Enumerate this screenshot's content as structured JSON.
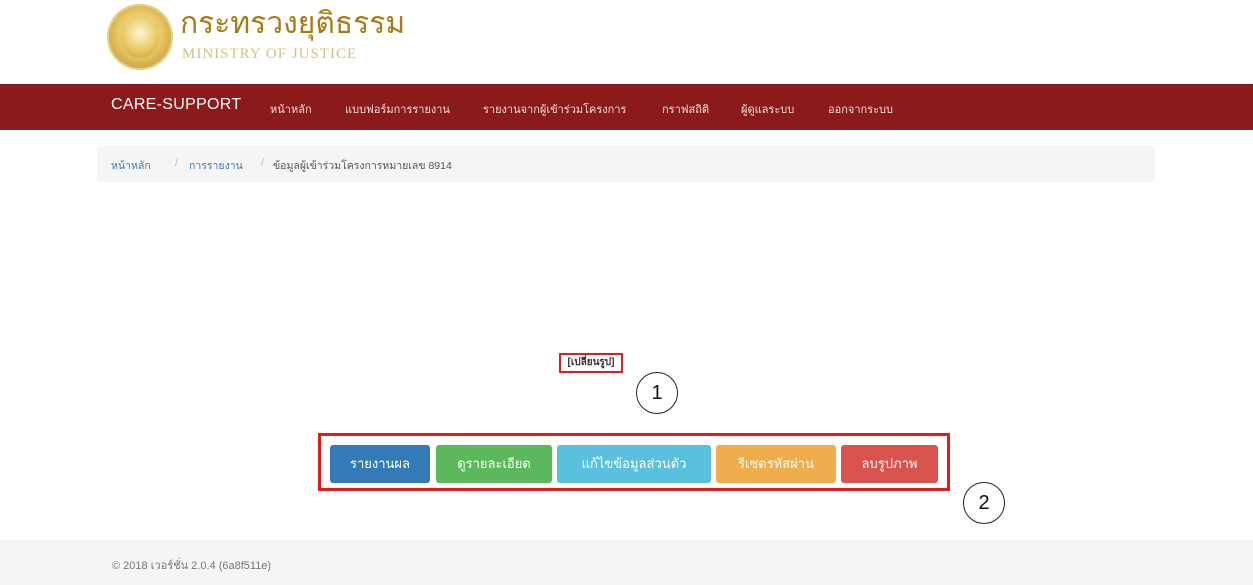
{
  "header": {
    "brand_thai": "กระทรวงยุติธรรม",
    "brand_english": "MINISTRY OF JUSTICE"
  },
  "navbar": {
    "brand": "CARE-SUPPORT",
    "items": [
      {
        "label": "หน้าหลัก"
      },
      {
        "label": "แบบฟอร์มการรายงาน"
      },
      {
        "label": "รายงานจากผู้เข้าร่วมโครงการ"
      },
      {
        "label": "กราฟสถิติ"
      },
      {
        "label": "ผู้ดูแลระบบ"
      },
      {
        "label": "ออกจากระบบ"
      }
    ],
    "color": "#8b1a1a"
  },
  "breadcrumb": {
    "home": "หน้าหลัก",
    "reports": "การรายงาน",
    "current": "ข้อมูลผู้เข้าร่วมโครงการหมายเลข 8914",
    "separator": "/"
  },
  "profile": {
    "change_photo": "[เปลี่ยนรูป]"
  },
  "annotations": {
    "one": "1",
    "two": "2"
  },
  "actions": {
    "report": "รายงานผล",
    "details": "ดูรายละเอียด",
    "edit": "แก้ไขข้อมูลส่วนตัว",
    "reset": "รีเซตรหัสผ่าน",
    "delete_photo": "ลบรูปภาพ"
  },
  "colors": {
    "primary": "#337ab7",
    "success": "#5cb85c",
    "info": "#5bc0de",
    "warning": "#f0ad4e",
    "danger": "#d9534f",
    "highlight": "#e31b1b"
  },
  "footer": {
    "copyright": "© 2018 เวอร์ชั่น 2.0.4 (6a8f511e)"
  }
}
